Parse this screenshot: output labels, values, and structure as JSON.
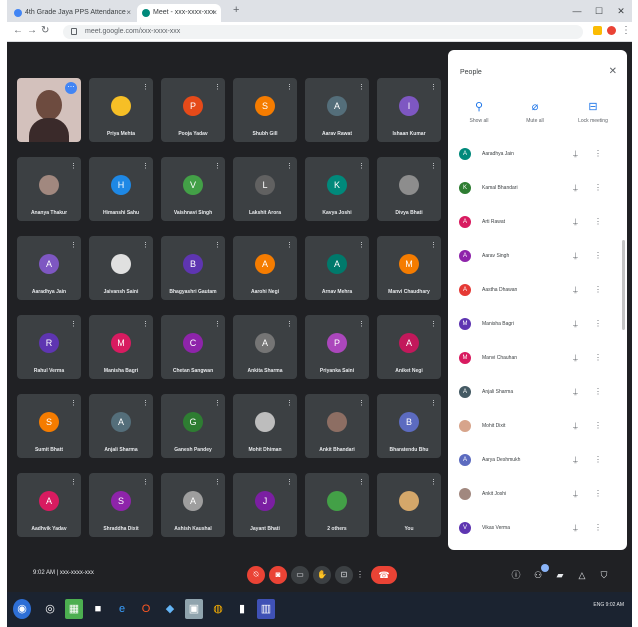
{
  "browser": {
    "tabs": [
      {
        "label": "4th Grade Jaya PPS Attendance"
      },
      {
        "label": "Meet - xxx-xxxx-xxx"
      }
    ],
    "url": "meet.google.com/xxx-xxxx-xxx"
  },
  "meeting": {
    "info": "9:02 AM  |  xxx-xxxx-xxx"
  },
  "tiles": [
    {
      "name": "",
      "initial": "",
      "color": "#d3c1bc",
      "self": true
    },
    {
      "name": "Priya Mehta",
      "initial": "",
      "color": "#f6bf26"
    },
    {
      "name": "Pooja Yadav",
      "initial": "P",
      "color": "#e64a19"
    },
    {
      "name": "Shubh Gill",
      "initial": "S",
      "color": "#f57c00"
    },
    {
      "name": "Aarav Rawat",
      "initial": "A",
      "color": "#546e7a"
    },
    {
      "name": "Ishaan Kumar",
      "initial": "I",
      "color": "#7e57c2"
    },
    {
      "name": "Ananya Thakur",
      "initial": "",
      "color": "#a1887f"
    },
    {
      "name": "Himanshi Sahu",
      "initial": "H",
      "color": "#1e88e5"
    },
    {
      "name": "Vaishnavi Singh",
      "initial": "V",
      "color": "#43a047"
    },
    {
      "name": "Lakshit Arora",
      "initial": "L",
      "color": "#616161"
    },
    {
      "name": "Kavya Joshi",
      "initial": "K",
      "color": "#00897b"
    },
    {
      "name": "Divya Bhati",
      "initial": "",
      "color": "#8d8d8d"
    },
    {
      "name": "Aaradhya Jain",
      "initial": "A",
      "color": "#7e57c2"
    },
    {
      "name": "Jaivansh Saini",
      "initial": "",
      "color": "#e0e0e0"
    },
    {
      "name": "Bhagyashri Gautam",
      "initial": "B",
      "color": "#5e35b1"
    },
    {
      "name": "Aarohi Negi",
      "initial": "A",
      "color": "#f57c00"
    },
    {
      "name": "Arnav Mehra",
      "initial": "A",
      "color": "#00796b"
    },
    {
      "name": "Manvi Chaudhary",
      "initial": "M",
      "color": "#f57c00"
    },
    {
      "name": "Rahul Verma",
      "initial": "R",
      "color": "#5e35b1"
    },
    {
      "name": "Manisha Bagri",
      "initial": "M",
      "color": "#d81b60"
    },
    {
      "name": "Chetan Sangwan",
      "initial": "C",
      "color": "#8e24aa"
    },
    {
      "name": "Ankita Sharma",
      "initial": "A",
      "color": "#757575"
    },
    {
      "name": "Priyanka Saini",
      "initial": "P",
      "color": "#ab47bc"
    },
    {
      "name": "Aniket Negi",
      "initial": "A",
      "color": "#c2185b"
    },
    {
      "name": "Sumit Bhatt",
      "initial": "S",
      "color": "#f57c00"
    },
    {
      "name": "Anjali Sharma",
      "initial": "A",
      "color": "#546e7a"
    },
    {
      "name": "Ganesh Pandey",
      "initial": "G",
      "color": "#2e7d32"
    },
    {
      "name": "Mohit Dhiman",
      "initial": "",
      "color": "#bdbdbd"
    },
    {
      "name": "Ankit Bhandari",
      "initial": "",
      "color": "#8d6e63"
    },
    {
      "name": "Bharatendu Bhu",
      "initial": "B",
      "color": "#5c6bc0"
    },
    {
      "name": "Aadhvik Yadav",
      "initial": "A",
      "color": "#d81b60"
    },
    {
      "name": "Shraddha Dixit",
      "initial": "S",
      "color": "#8e24aa"
    },
    {
      "name": "Ashish Kaushal",
      "initial": "A",
      "color": "#9e9e9e"
    },
    {
      "name": "Jayant Bhati",
      "initial": "J",
      "color": "#7b1fa2"
    },
    {
      "name": "2 others",
      "initial": "",
      "color": "#43a047"
    },
    {
      "name": "You",
      "initial": "",
      "color": "#d4a76a"
    }
  ],
  "controls": {
    "mic_icon": "mic-off-icon",
    "cam_icon": "camera-off-icon",
    "end_icon": "end-call-icon"
  },
  "people_panel": {
    "title": "People",
    "actions": [
      {
        "icon": "add-person-icon",
        "label": "Show all"
      },
      {
        "icon": "mute-all-icon",
        "label": "Mute all"
      },
      {
        "icon": "remove-icon",
        "label": "Lock meeting"
      }
    ],
    "participants": [
      {
        "name": "Aaradhya Jain",
        "initial": "A",
        "color": "#00897b"
      },
      {
        "name": "Kamal Bhandari",
        "initial": "K",
        "color": "#2e7d32"
      },
      {
        "name": "Arti Rawat",
        "initial": "A",
        "color": "#d81b60"
      },
      {
        "name": "Aarav Singh",
        "initial": "A",
        "color": "#8e24aa"
      },
      {
        "name": "Aastha Dhawan",
        "initial": "A",
        "color": "#e53935"
      },
      {
        "name": "Manisha Bagri",
        "initial": "M",
        "color": "#5e35b1"
      },
      {
        "name": "Manvi Chauhan",
        "initial": "M",
        "color": "#d81b60"
      },
      {
        "name": "Anjali Sharma",
        "initial": "A",
        "color": "#455a64"
      },
      {
        "name": "Mohit Dixit",
        "initial": "",
        "color": "#d7a48b"
      },
      {
        "name": "Aarya Deshmukh",
        "initial": "A",
        "color": "#5c6bc0"
      },
      {
        "name": "Ankit Joshi",
        "initial": "",
        "color": "#a1887f"
      },
      {
        "name": "Vikas Verma",
        "initial": "V",
        "color": "#5e35b1"
      }
    ]
  },
  "taskbar": {
    "tray_text": "ENG  9:02 AM"
  }
}
